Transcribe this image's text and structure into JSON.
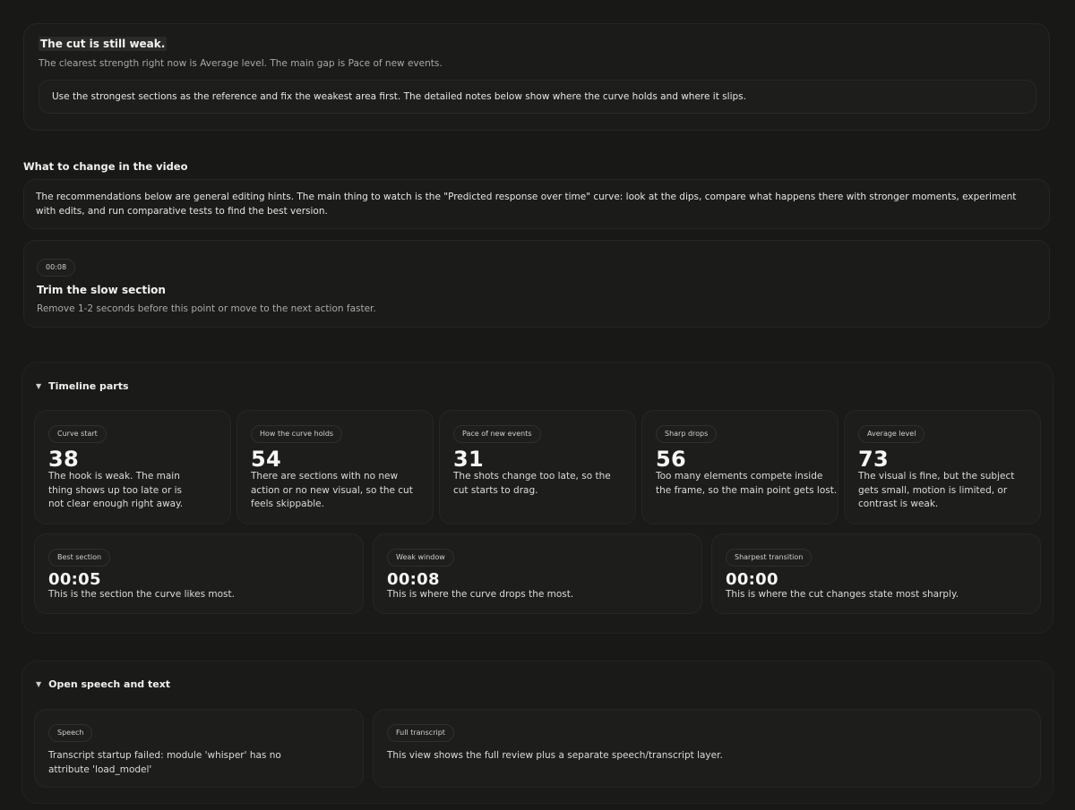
{
  "summary": {
    "title": "The cut is still weak.",
    "subtitle": "The clearest strength right now is Average level. The main gap is Pace of new events.",
    "note": "Use the strongest sections as the reference and fix the weakest area first. The detailed notes below show where the curve holds and where it slips."
  },
  "recommendations": {
    "heading": "What to change in the video",
    "intro": "The recommendations below are general editing hints. The main thing to watch is the \"Predicted response over time\" curve: look at the dips, compare what happens there with stronger moments, experiment with edits, and run comparative tests to find the best version.",
    "items": [
      {
        "time": "00:08",
        "title": "Trim the slow section",
        "description": "Remove 1-2 seconds before this point or move to the next action faster."
      }
    ]
  },
  "timeline": {
    "heading": "Timeline parts",
    "toggle_icon": "triangle-down",
    "metrics": [
      {
        "label": "Curve start",
        "value": "38",
        "description": "The hook is weak. The main thing shows up too late or is not clear enough right away."
      },
      {
        "label": "How the curve holds",
        "value": "54",
        "description": "There are sections with no new action or no new visual, so the cut feels skippable."
      },
      {
        "label": "Pace of new events",
        "value": "31",
        "description": "The shots change too late, so the cut starts to drag."
      },
      {
        "label": "Sharp drops",
        "value": "56",
        "description": "Too many elements compete inside the frame, so the main point gets lost."
      },
      {
        "label": "Average level",
        "value": "73",
        "description": "The visual is fine, but the subject gets small, motion is limited, or contrast is weak."
      }
    ],
    "moments": [
      {
        "label": "Best section",
        "value": "00:05",
        "description": "This is the section the curve likes most."
      },
      {
        "label": "Weak window",
        "value": "00:08",
        "description": "This is where the curve drops the most."
      },
      {
        "label": "Sharpest transition",
        "value": "00:00",
        "description": "This is where the cut changes state most sharply."
      }
    ]
  },
  "speech": {
    "heading": "Open speech and text",
    "toggle_icon": "triangle-down",
    "cards": [
      {
        "label": "Speech",
        "text": "Transcript startup failed: module 'whisper' has no attribute 'load_model'"
      },
      {
        "label": "Full transcript",
        "text": "This view shows the full review plus a separate speech/transcript layer."
      }
    ]
  },
  "colors": {
    "background": "#181917",
    "card": "#1d1e1c",
    "text": "#e9e9e6",
    "muted": "#a9aaa5"
  }
}
